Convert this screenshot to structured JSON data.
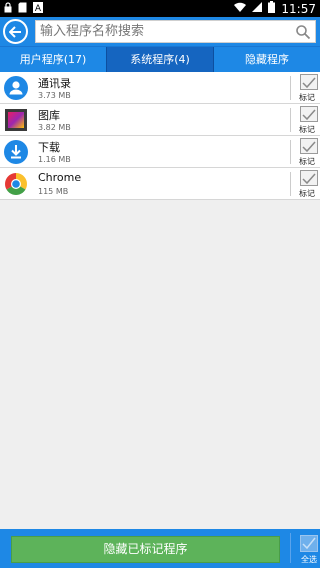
{
  "status_bar": {
    "time": "11:57"
  },
  "search": {
    "placeholder": "输入程序名称搜索"
  },
  "tabs": [
    {
      "label": "用户程序(17)",
      "active": false
    },
    {
      "label": "系统程序(4)",
      "active": true
    },
    {
      "label": "隐藏程序",
      "active": false
    }
  ],
  "apps": [
    {
      "name": "通讯录",
      "size": "3.73 MB",
      "mark_label": "标记",
      "icon": "contacts-icon"
    },
    {
      "name": "图库",
      "size": "3.82 MB",
      "mark_label": "标记",
      "icon": "gallery-icon"
    },
    {
      "name": "下载",
      "size": "1.16 MB",
      "mark_label": "标记",
      "icon": "download-icon"
    },
    {
      "name": "Chrome",
      "size": "115 MB",
      "mark_label": "标记",
      "icon": "chrome-icon"
    }
  ],
  "bottom": {
    "hide_button_label": "隐藏已标记程序",
    "select_all_label": "全选"
  },
  "colors": {
    "primary": "#1e88e5",
    "tab_active": "#1565c0",
    "green_button": "#5db35a"
  }
}
